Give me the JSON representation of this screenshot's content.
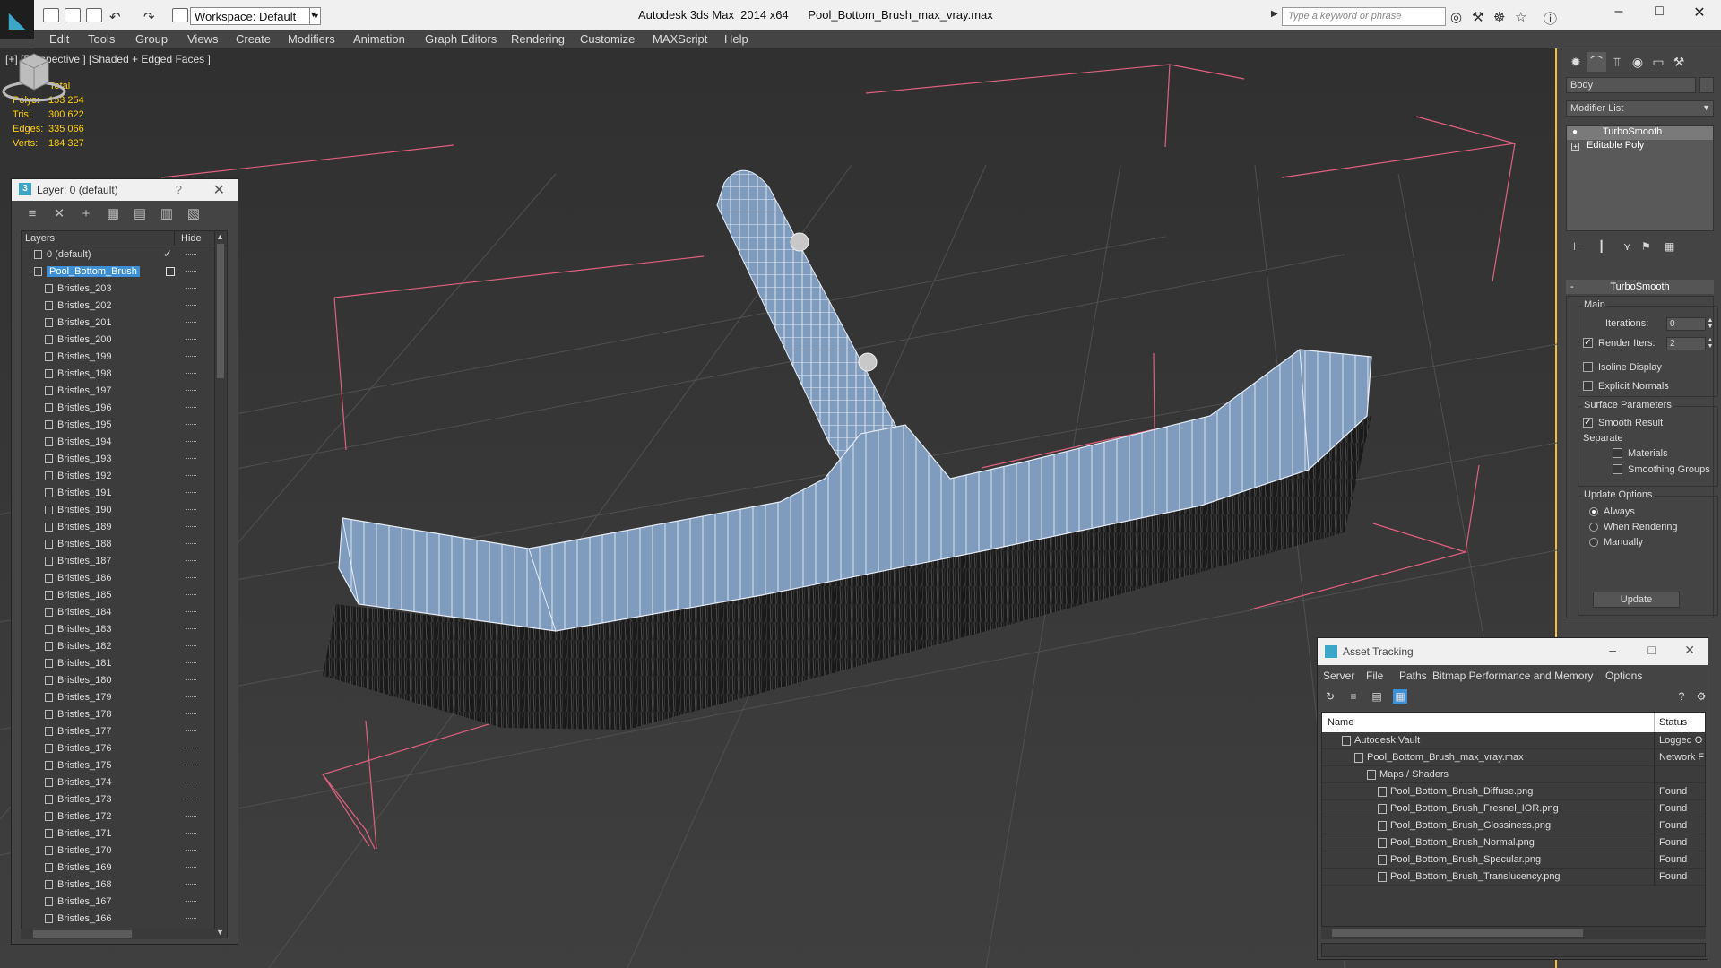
{
  "app": {
    "title": "Autodesk 3ds Max  2014 x64",
    "file": "Pool_Bottom_Brush_max_vray.max",
    "workspace": "Workspace: Default",
    "search_placeholder": "Type a keyword or phrase"
  },
  "menu": [
    "Edit",
    "Tools",
    "Group",
    "Views",
    "Create",
    "Modifiers",
    "Animation",
    "Graph Editors",
    "Rendering",
    "Customize",
    "MAXScript",
    "Help"
  ],
  "viewport": {
    "label": "[+] [Perspective ] [Shaded + Edged Faces ]",
    "stats": {
      "header": "Total",
      "rows": [
        {
          "label": "Polys:",
          "value": "153 254"
        },
        {
          "label": "Tris:",
          "value": "300 622"
        },
        {
          "label": "Edges:",
          "value": "335 066"
        },
        {
          "label": "Verts:",
          "value": "184 327"
        }
      ]
    }
  },
  "layer_panel": {
    "title": "Layer: 0 (default)",
    "help": "?",
    "col_layers": "Layers",
    "col_hide": "Hide",
    "layers": [
      {
        "name": "0 (default)"
      },
      {
        "name": "Pool_Bottom_Brush"
      },
      {
        "name": "Bristles_203"
      },
      {
        "name": "Bristles_202"
      },
      {
        "name": "Bristles_201"
      },
      {
        "name": "Bristles_200"
      },
      {
        "name": "Bristles_199"
      },
      {
        "name": "Bristles_198"
      },
      {
        "name": "Bristles_197"
      },
      {
        "name": "Bristles_196"
      },
      {
        "name": "Bristles_195"
      },
      {
        "name": "Bristles_194"
      },
      {
        "name": "Bristles_193"
      },
      {
        "name": "Bristles_192"
      },
      {
        "name": "Bristles_191"
      },
      {
        "name": "Bristles_190"
      },
      {
        "name": "Bristles_189"
      },
      {
        "name": "Bristles_188"
      },
      {
        "name": "Bristles_187"
      },
      {
        "name": "Bristles_186"
      },
      {
        "name": "Bristles_185"
      },
      {
        "name": "Bristles_184"
      },
      {
        "name": "Bristles_183"
      },
      {
        "name": "Bristles_182"
      },
      {
        "name": "Bristles_181"
      },
      {
        "name": "Bristles_180"
      },
      {
        "name": "Bristles_179"
      },
      {
        "name": "Bristles_178"
      },
      {
        "name": "Bristles_177"
      },
      {
        "name": "Bristles_176"
      },
      {
        "name": "Bristles_175"
      },
      {
        "name": "Bristles_174"
      },
      {
        "name": "Bristles_173"
      },
      {
        "name": "Bristles_172"
      },
      {
        "name": "Bristles_171"
      },
      {
        "name": "Bristles_170"
      },
      {
        "name": "Bristles_169"
      },
      {
        "name": "Bristles_168"
      },
      {
        "name": "Bristles_167"
      },
      {
        "name": "Bristles_166"
      }
    ]
  },
  "command_panel": {
    "object_name": "Body",
    "modifier_list": "Modifier List",
    "stack": [
      "TurboSmooth",
      "Editable Poly"
    ],
    "rollout_title": "TurboSmooth",
    "main_group": "Main",
    "iterations_label": "Iterations:",
    "iterations_value": "0",
    "render_iters_label": "Render Iters:",
    "render_iters_value": "2",
    "isoline_display": "Isoline Display",
    "explicit_normals": "Explicit Normals",
    "surface_group": "Surface Parameters",
    "smooth_result": "Smooth Result",
    "separate_label": "Separate",
    "materials": "Materials",
    "smoothing_groups": "Smoothing Groups",
    "update_group": "Update Options",
    "always": "Always",
    "when_rendering": "When Rendering",
    "manually": "Manually",
    "update_button": "Update"
  },
  "asset_tracking": {
    "title": "Asset Tracking",
    "menu": [
      "Server",
      "File",
      "Paths",
      "Bitmap Performance and Memory",
      "Options"
    ],
    "col_name": "Name",
    "col_status": "Status",
    "rows": [
      {
        "name": "Autodesk Vault",
        "status": "Logged O"
      },
      {
        "name": "Pool_Bottom_Brush_max_vray.max",
        "status": "Network F"
      },
      {
        "name": "Maps / Shaders",
        "status": ""
      },
      {
        "name": "Pool_Bottom_Brush_Diffuse.png",
        "status": "Found"
      },
      {
        "name": "Pool_Bottom_Brush_Fresnel_IOR.png",
        "status": "Found"
      },
      {
        "name": "Pool_Bottom_Brush_Glossiness.png",
        "status": "Found"
      },
      {
        "name": "Pool_Bottom_Brush_Normal.png",
        "status": "Found"
      },
      {
        "name": "Pool_Bottom_Brush_Specular.png",
        "status": "Found"
      },
      {
        "name": "Pool_Bottom_Brush_Translucency.png",
        "status": "Found"
      }
    ]
  },
  "colors": {
    "accent_selection": "#3d8fd6",
    "stats_text": "#ffd100",
    "active_viewport_border": "#f0c040",
    "model_body": "#7f9bbd",
    "bounding_box": "#e0607f"
  }
}
